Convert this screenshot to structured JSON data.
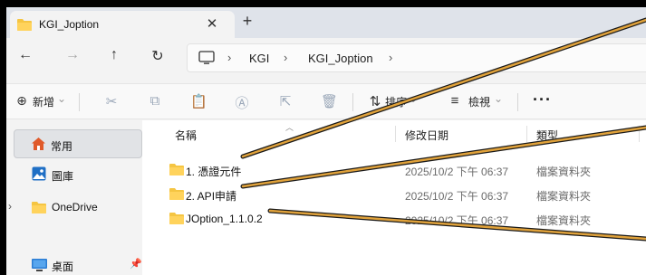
{
  "tab": {
    "title": "KGI_Joption",
    "close_glyph": "✕",
    "new_tab_glyph": "+"
  },
  "nav": {
    "back": "←",
    "forward": "→",
    "up": "↑",
    "refresh": "↻"
  },
  "breadcrumb": {
    "items": [
      "KGI",
      "KGI_Joption"
    ],
    "separator": "›"
  },
  "commands": {
    "new_label": "新增",
    "new_dropdown": "⌄",
    "sort_label": "排序",
    "view_label": "檢視",
    "more": "···"
  },
  "sidebar": {
    "items": [
      {
        "label": "常用",
        "icon": "home-icon"
      },
      {
        "label": "圖庫",
        "icon": "gallery-icon"
      },
      {
        "label": "OneDrive",
        "icon": "folder-icon"
      },
      {
        "label": "桌面",
        "icon": "desktop-icon"
      }
    ],
    "expand_glyph": "›",
    "pin_glyph": "📌"
  },
  "columns": {
    "name": "名稱",
    "modified": "修改日期",
    "type": "類型"
  },
  "files": [
    {
      "name": "1. 憑證元件",
      "modified": "2025/10/2 下午 06:37",
      "type": "檔案資料夾"
    },
    {
      "name": "2. API申請",
      "modified": "2025/10/2 下午 06:37",
      "type": "檔案資料夾"
    },
    {
      "name": "JOption_1.1.0.2",
      "modified": "2025/10/2 下午 06:37",
      "type": "檔案資料夾"
    }
  ],
  "colors": {
    "annotation": "#e0a23b",
    "folder": "#f5c542",
    "accent": "#0067c0"
  }
}
